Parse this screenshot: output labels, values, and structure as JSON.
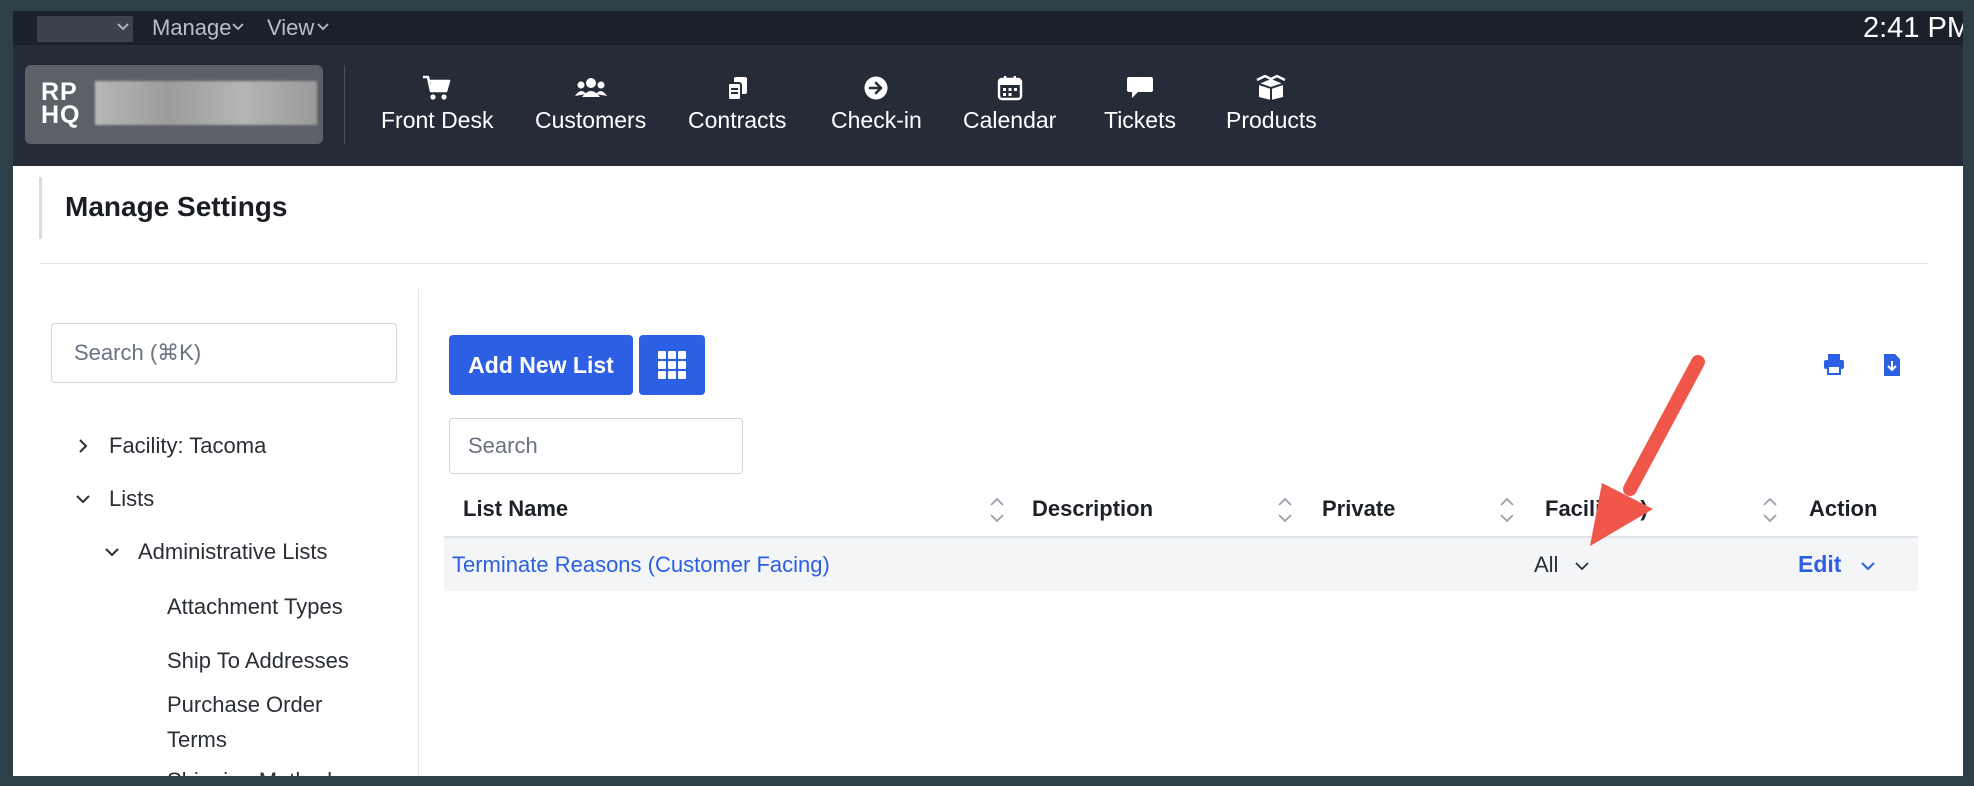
{
  "menubar": {
    "items": [
      {
        "label": "Manage"
      },
      {
        "label": "View"
      }
    ],
    "clock": "2:41 PM"
  },
  "logo": {
    "text_line1": "RP",
    "text_line2": "HQ"
  },
  "nav": [
    {
      "label": "Front Desk",
      "icon": "cart-icon"
    },
    {
      "label": "Customers",
      "icon": "users-icon"
    },
    {
      "label": "Contracts",
      "icon": "contracts-icon"
    },
    {
      "label": "Check-in",
      "icon": "arrow-circle-icon"
    },
    {
      "label": "Calendar",
      "icon": "calendar-icon"
    },
    {
      "label": "Tickets",
      "icon": "chat-icon"
    },
    {
      "label": "Products",
      "icon": "box-icon"
    }
  ],
  "page": {
    "title": "Manage Settings"
  },
  "sidebar": {
    "search_placeholder": "Search (⌘K)",
    "tree": [
      {
        "label": "Facility: Tacoma",
        "state": "collapsed"
      },
      {
        "label": "Lists",
        "state": "expanded"
      },
      {
        "label": "Administrative Lists",
        "state": "expanded"
      },
      {
        "label": "Attachment Types"
      },
      {
        "label": "Ship To Addresses"
      },
      {
        "label": "Purchase Order Terms"
      },
      {
        "label": "Shipping Methods"
      }
    ]
  },
  "main": {
    "add_button": "Add New List",
    "search_placeholder": "Search",
    "columns": [
      "List Name",
      "Description",
      "Private",
      "Facility(s)",
      "Action"
    ],
    "rows": [
      {
        "list_name": "Terminate Reasons (Customer Facing)",
        "description": "",
        "private": "",
        "facilities": "All",
        "action": "Edit"
      }
    ]
  },
  "colors": {
    "accent": "#2c5fe3",
    "toolbar_bg": "#252c38",
    "menubar_bg": "#1b212b",
    "annotation_arrow": "#f0574a"
  }
}
